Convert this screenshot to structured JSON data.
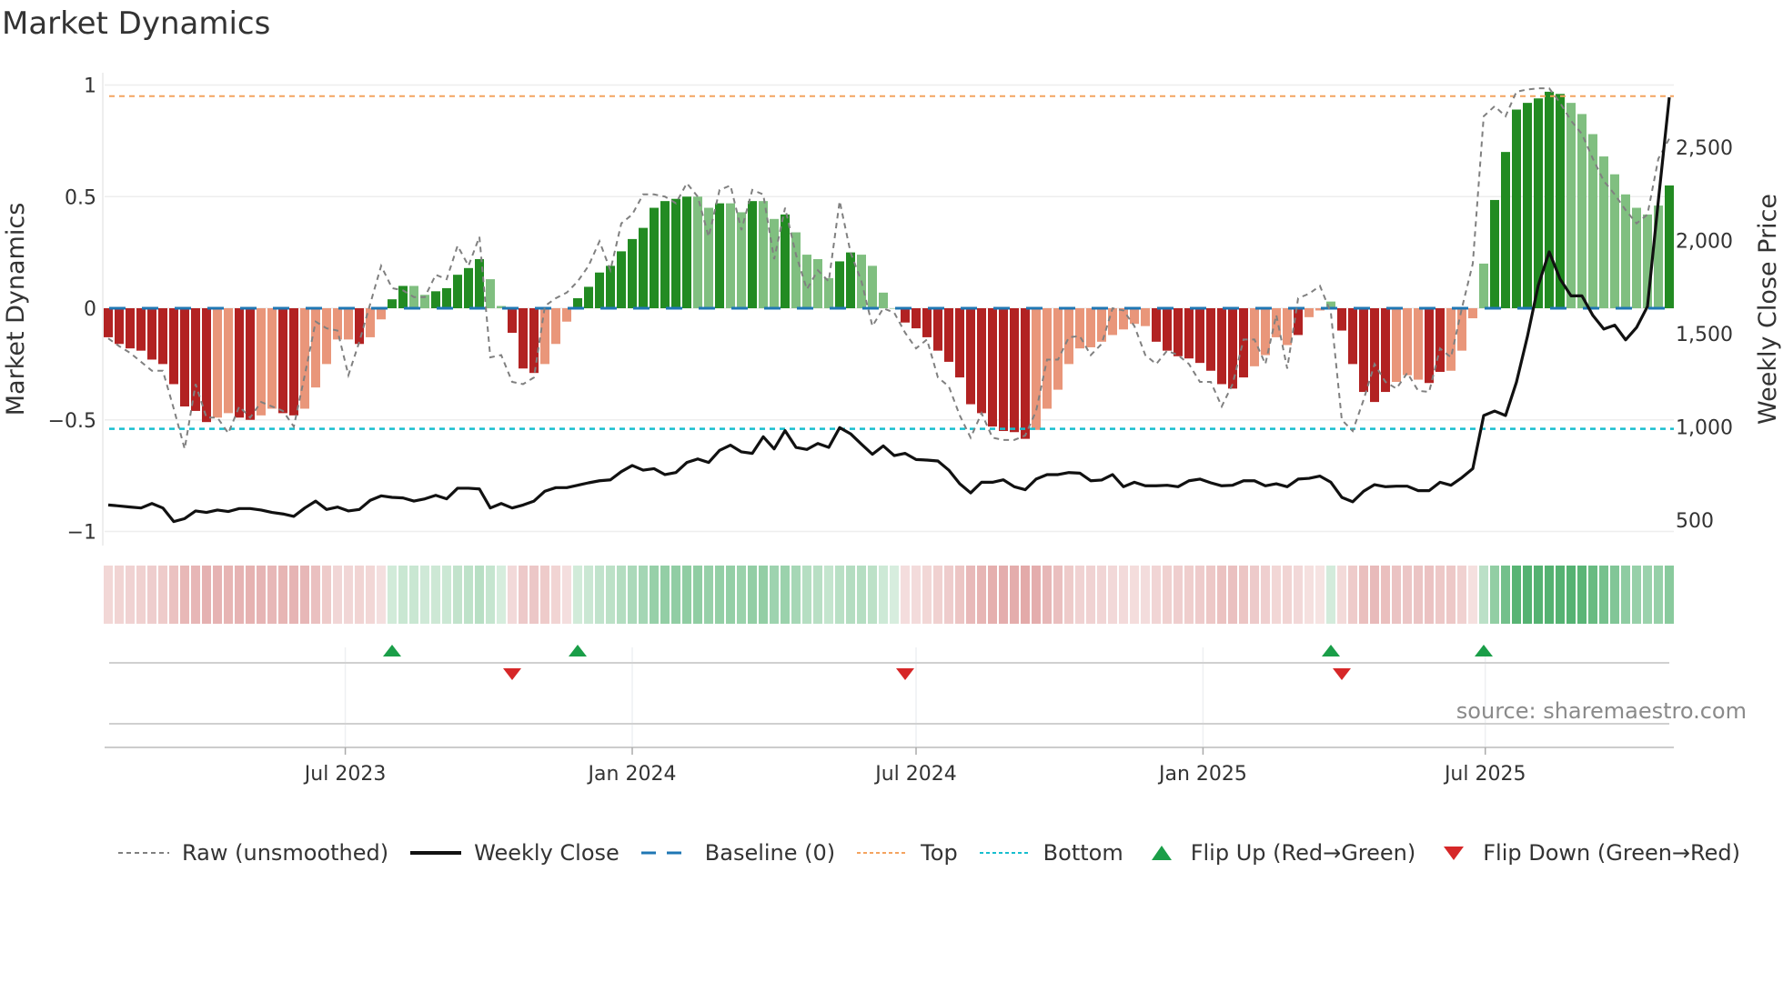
{
  "title": "Market Dynamics",
  "source": "source: sharemaestro.com",
  "chart_data": {
    "type": "bar",
    "title": "Market Dynamics",
    "ylabel": "Market Dynamics",
    "y2label": "Weekly Close Price",
    "ylim": [
      -1.05,
      1.05
    ],
    "y2lim": [
      300,
      2900
    ],
    "yticks": [
      {
        "v": 1,
        "label": "1"
      },
      {
        "v": 0.5,
        "label": "0.5"
      },
      {
        "v": 0,
        "label": "0"
      },
      {
        "v": -0.5,
        "label": "−0.5"
      },
      {
        "v": -1,
        "label": "−1"
      }
    ],
    "y2ticks": [
      {
        "v": 2500,
        "label": "2,500"
      },
      {
        "v": 2000,
        "label": "2,000"
      },
      {
        "v": 1500,
        "label": "1,500"
      },
      {
        "v": 1000,
        "label": "1,000"
      },
      {
        "v": 500,
        "label": "500"
      }
    ],
    "start_date": "2023-01-30",
    "frequency": "weekly",
    "xticks": [
      {
        "date": "2023-07-01",
        "label": "Jul 2023"
      },
      {
        "date": "2024-01-01",
        "label": "Jan 2024"
      },
      {
        "date": "2024-07-01",
        "label": "Jul 2024"
      },
      {
        "date": "2025-01-01",
        "label": "Jan 2025"
      },
      {
        "date": "2025-07-01",
        "label": "Jul 2025"
      }
    ],
    "top_level": 0.95,
    "bottom_level": -0.54,
    "baseline": 0,
    "smoothed": [
      -0.13,
      -0.16,
      -0.18,
      -0.19,
      -0.23,
      -0.25,
      -0.34,
      -0.44,
      -0.46,
      -0.51,
      -0.49,
      -0.47,
      -0.49,
      -0.5,
      -0.48,
      -0.45,
      -0.47,
      -0.48,
      -0.45,
      -0.355,
      -0.25,
      -0.14,
      -0.14,
      -0.16,
      -0.13,
      -0.05,
      0.04,
      0.1,
      0.1,
      0.06,
      0.076,
      0.09,
      0.15,
      0.18,
      0.22,
      0.13,
      0.01,
      -0.11,
      -0.27,
      -0.29,
      -0.25,
      -0.16,
      -0.06,
      0.045,
      0.096,
      0.16,
      0.19,
      0.255,
      0.31,
      0.36,
      0.45,
      0.48,
      0.49,
      0.5,
      0.5,
      0.45,
      0.47,
      0.47,
      0.43,
      0.48,
      0.48,
      0.4,
      0.42,
      0.34,
      0.24,
      0.22,
      0.135,
      0.21,
      0.25,
      0.24,
      0.19,
      0.07,
      0.0,
      -0.064,
      -0.09,
      -0.13,
      -0.19,
      -0.24,
      -0.31,
      -0.43,
      -0.47,
      -0.53,
      -0.55,
      -0.555,
      -0.585,
      -0.545,
      -0.45,
      -0.365,
      -0.25,
      -0.18,
      -0.175,
      -0.15,
      -0.12,
      -0.095,
      -0.07,
      -0.08,
      -0.15,
      -0.19,
      -0.215,
      -0.225,
      -0.245,
      -0.28,
      -0.34,
      -0.36,
      -0.31,
      -0.26,
      -0.21,
      -0.13,
      -0.165,
      -0.12,
      -0.04,
      -0.01,
      0.03,
      -0.1,
      -0.25,
      -0.375,
      -0.42,
      -0.375,
      -0.33,
      -0.3,
      -0.32,
      -0.335,
      -0.285,
      -0.28,
      -0.19,
      -0.045,
      0.2,
      0.485,
      0.7,
      0.89,
      0.92,
      0.94,
      0.97,
      0.96,
      0.92,
      0.87,
      0.78,
      0.68,
      0.6,
      0.51,
      0.45,
      0.42,
      0.46,
      0.55
    ],
    "strengthening": "DDDDDDDDDDLLDDLLDDLLLLLDLLDDLLDDDDDLLDDDLLLDDDDDDDDDDDLLDLLDLLDLLLLDDLLLLDDDDDDDDDDDDLLLLLLLLLLLDDDDDDDDDLLLLDLLLDDDDDLLLDDLLLLDDDDDDDLLLLLLLLLDD",
    "raw": [
      -0.135,
      -0.17,
      -0.2,
      -0.24,
      -0.28,
      -0.28,
      -0.45,
      -0.63,
      -0.34,
      -0.49,
      -0.49,
      -0.56,
      -0.44,
      -0.49,
      -0.42,
      -0.44,
      -0.46,
      -0.53,
      -0.3,
      -0.06,
      -0.09,
      -0.1,
      -0.3,
      -0.15,
      0.02,
      0.19,
      0.09,
      0.08,
      0.05,
      0.05,
      0.15,
      0.13,
      0.28,
      0.19,
      0.32,
      -0.22,
      -0.21,
      -0.33,
      -0.34,
      -0.31,
      0.01,
      0.045,
      0.07,
      0.12,
      0.19,
      0.3,
      0.17,
      0.38,
      0.42,
      0.51,
      0.51,
      0.5,
      0.47,
      0.56,
      0.5,
      0.32,
      0.53,
      0.55,
      0.35,
      0.53,
      0.51,
      0.22,
      0.45,
      0.24,
      0.085,
      0.17,
      0.12,
      0.48,
      0.25,
      0.12,
      -0.08,
      0.0,
      -0.02,
      -0.11,
      -0.18,
      -0.14,
      -0.31,
      -0.35,
      -0.48,
      -0.58,
      -0.47,
      -0.58,
      -0.59,
      -0.59,
      -0.57,
      -0.46,
      -0.23,
      -0.23,
      -0.13,
      -0.125,
      -0.21,
      -0.16,
      0.0,
      -0.01,
      -0.08,
      -0.21,
      -0.25,
      -0.19,
      -0.21,
      -0.25,
      -0.33,
      -0.33,
      -0.44,
      -0.34,
      -0.14,
      -0.14,
      -0.25,
      -0.03,
      -0.27,
      0.045,
      0.065,
      0.1,
      -0.02,
      -0.5,
      -0.55,
      -0.41,
      -0.25,
      -0.33,
      -0.36,
      -0.29,
      -0.37,
      -0.375,
      -0.18,
      -0.22,
      0.0,
      0.2,
      0.86,
      0.905,
      0.86,
      0.97,
      0.98,
      0.985,
      0.985,
      0.92,
      0.84,
      0.78,
      0.67,
      0.57,
      0.51,
      0.44,
      0.38,
      0.42,
      0.67,
      0.76
    ],
    "weekly_close": [
      581,
      576,
      570,
      565,
      589,
      565,
      492,
      508,
      549,
      541,
      554,
      546,
      562,
      562,
      554,
      541,
      533,
      520,
      565,
      602,
      557,
      570,
      549,
      557,
      606,
      630,
      622,
      619,
      602,
      614,
      633,
      614,
      671,
      671,
      667,
      565,
      589,
      565,
      581,
      602,
      655,
      674,
      674,
      687,
      700,
      711,
      716,
      760,
      793,
      768,
      776,
      744,
      755,
      809,
      828,
      809,
      874,
      902,
      866,
      858,
      947,
      882,
      980,
      890,
      879,
      911,
      890,
      996,
      963,
      907,
      853,
      898,
      846,
      858,
      825,
      822,
      817,
      768,
      695,
      646,
      703,
      703,
      716,
      679,
      663,
      720,
      744,
      744,
      755,
      752,
      711,
      715,
      744,
      679,
      703,
      684,
      684,
      687,
      679,
      711,
      720,
      700,
      684,
      687,
      711,
      711,
      684,
      695,
      679,
      720,
      724,
      736,
      703,
      622,
      598,
      655,
      690,
      679,
      682,
      682,
      658,
      658,
      703,
      687,
      728,
      776,
      1061,
      1085,
      1061,
      1240,
      1484,
      1760,
      1939,
      1793,
      1703,
      1703,
      1598,
      1525,
      1546,
      1467,
      1533,
      1646,
      2215,
      2768
    ],
    "flip_up_weeks": [
      26,
      43,
      112,
      126
    ],
    "flip_down_weeks": [
      37,
      73,
      113
    ],
    "colors": {
      "strong_red": "#b22222",
      "weak_red": "#e9967a",
      "strong_green": "#228b22",
      "weak_green": "#80bf80",
      "raw": "#808080",
      "close": "#111111",
      "baseline": "#1f77b4",
      "top": "#f4a460",
      "bottom": "#17becf",
      "flip_up": "#1a9e48",
      "flip_down": "#d62728"
    },
    "legend": {
      "position": "bottom",
      "items": [
        {
          "key": "raw",
          "label": "Raw (unsmoothed)"
        },
        {
          "key": "close",
          "label": "Weekly Close"
        },
        {
          "key": "baseline",
          "label": "Baseline (0)"
        },
        {
          "key": "top",
          "label": "Top"
        },
        {
          "key": "bottom",
          "label": "Bottom"
        },
        {
          "key": "flip_up",
          "label": "Flip Up (Red→Green)"
        },
        {
          "key": "flip_down",
          "label": "Flip Down (Green→Red)"
        }
      ]
    }
  }
}
